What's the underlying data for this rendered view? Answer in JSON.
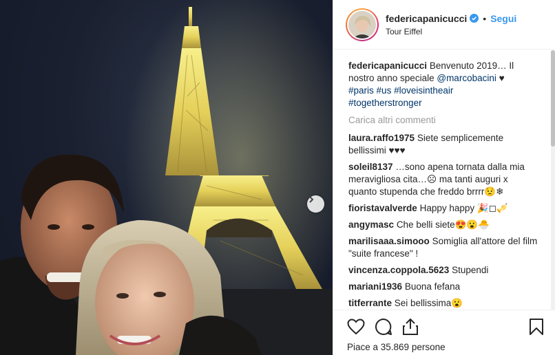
{
  "post": {
    "username": "federicapanicucci",
    "separator": "•",
    "follow_label": "Segui",
    "location": "Tour Eiffel"
  },
  "caption": {
    "username": "federicapanicucci",
    "text_a": "Benvenuto 2019… Il nostro anno speciale",
    "mention": "@marcobacini",
    "heart": "♥",
    "hashtags": [
      "#paris",
      "#us",
      "#loveisintheair",
      "#togetherstronger"
    ]
  },
  "load_more_label": "Carica altri commenti",
  "comments": [
    {
      "user": "laura.raffo1975",
      "text": "Siete semplicemente bellissimi ♥♥♥"
    },
    {
      "user": "soleil8137",
      "text": "…sono apena tornata dalla mia meravigliosa cita…☹ ma tanti auguri x quanto stupenda che freddo brrrr😟❄"
    },
    {
      "user": "fioristavalverde",
      "text": "Happy happy 🎉◻🎺"
    },
    {
      "user": "angymasc",
      "text": "Che belli siete😍😮🐣"
    },
    {
      "user": "marilisaaa.simooo",
      "text": "Somiglia all'attore del film \"suite francese\" !"
    },
    {
      "user": "vincenza.coppola.5623",
      "text": "Stupendi"
    },
    {
      "user": "mariani1936",
      "text": "Buona fefana"
    },
    {
      "user": "titferrante",
      "text": "Sei bellissima😮"
    }
  ],
  "likes_text": "Piace a 35.869 persone",
  "icons": [
    "verified-badge-icon",
    "heart-icon",
    "comment-icon",
    "share-icon",
    "bookmark-icon",
    "chevron-right-icon"
  ],
  "colors": {
    "link": "#3897f0",
    "hashtag": "#003569",
    "verified": "#3897f0"
  }
}
